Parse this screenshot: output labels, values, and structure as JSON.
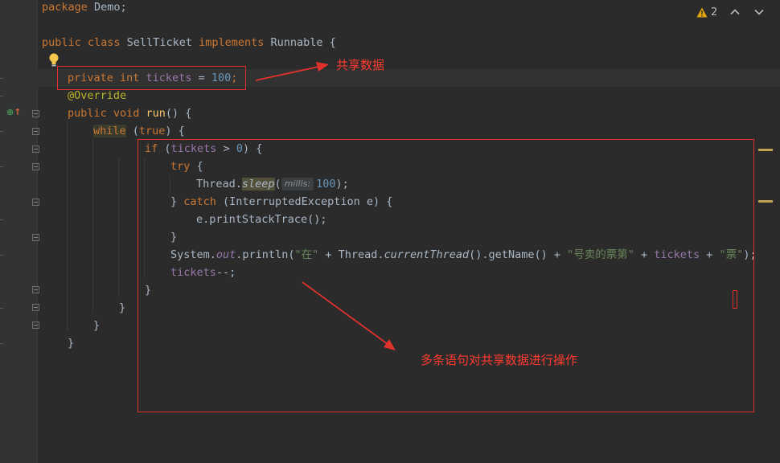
{
  "warnings": {
    "count": "2",
    "icon": "warning-triangle-icon"
  },
  "navigation": {
    "prev_icon": "chevron-up-icon",
    "next_icon": "chevron-down-icon"
  },
  "code": {
    "l1": {
      "kw": "package",
      "rest": " Demo;"
    },
    "l2": {
      "kw1": "public class",
      "cls": " SellTicket ",
      "kw2": "implements",
      "rest": " Runnable {"
    },
    "l3": {
      "kw": "private int",
      "field": "tickets",
      "eq": " = ",
      "num": "100",
      "semi": ";"
    },
    "l4": {
      "ann": "@Override"
    },
    "l5": {
      "kw": "public void",
      "name": " run",
      "rest": "() {"
    },
    "l6": {
      "kw": "while",
      "rest1": " (",
      "kw2": "true",
      "rest2": ") {"
    },
    "l7": {
      "kw": "if",
      "rest1": " (",
      "field": "tickets",
      "rest2": " > ",
      "num": "0",
      "rest3": ") {"
    },
    "l8": {
      "kw": "try",
      "rest": " {"
    },
    "l9": {
      "cls": "Thread.",
      "method": "sleep",
      "paren": "(",
      "hint": "millis:",
      "num": "100",
      "end": ");"
    },
    "l10": {
      "rest1": "} ",
      "kw": "catch",
      "rest2": " (InterruptedException e) {"
    },
    "l11": {
      "text": "e.printStackTrace();"
    },
    "l12": {
      "text": "}"
    },
    "l13": {
      "p1": "System.",
      "out": "out",
      "p2": ".println(",
      "s1": "\"在\"",
      "p3": " + Thread.",
      "ct": "currentThread",
      "p4": "().getName() + ",
      "s2": "\"号卖的票第\"",
      "p5": " + ",
      "field": "tickets",
      "p6": " + ",
      "s3": "\"票\"",
      "p7": ");"
    },
    "l14": {
      "field": "tickets",
      "rest": "--;"
    },
    "l15": {
      "text": "}"
    },
    "l16": {
      "text": "}"
    },
    "l17": {
      "text": "}"
    },
    "l18": {
      "text": "}"
    }
  },
  "annotations": {
    "shared_data": "共享数据",
    "multi_statements": "多条语句对共享数据进行操作",
    "color": "#e0322d"
  }
}
